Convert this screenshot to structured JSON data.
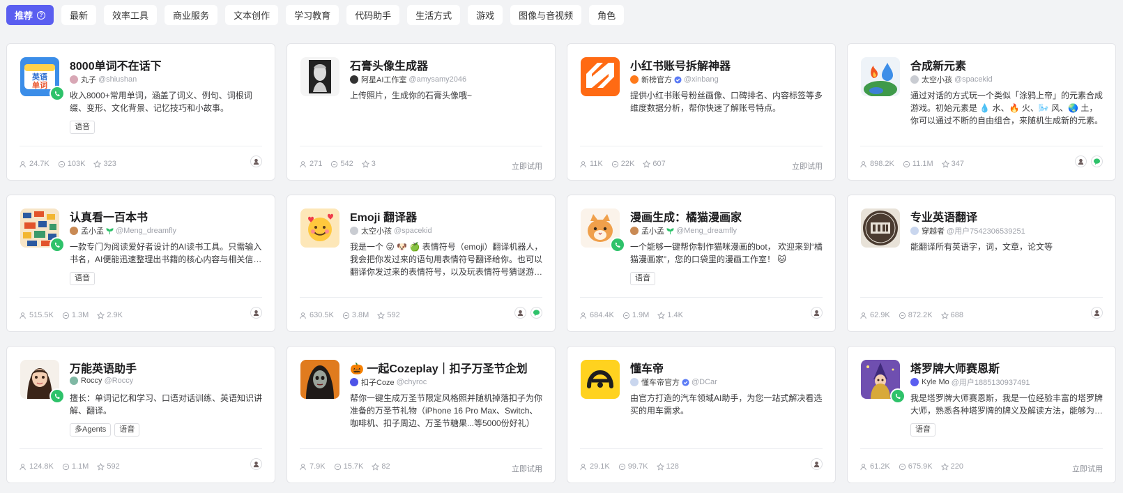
{
  "tabs": [
    {
      "label": "推荐",
      "active": true
    },
    {
      "label": "最新"
    },
    {
      "label": "效率工具"
    },
    {
      "label": "商业服务"
    },
    {
      "label": "文本创作"
    },
    {
      "label": "学习教育"
    },
    {
      "label": "代码助手"
    },
    {
      "label": "生活方式"
    },
    {
      "label": "游戏"
    },
    {
      "label": "图像与音视频"
    },
    {
      "label": "角色"
    }
  ],
  "help_icon": "?",
  "cards": [
    {
      "title": "8000单词不在话下",
      "author": "丸子",
      "handle": "@shiushan",
      "desc": "收入8000+常用单词，涵盖了词义、例句、词根词缀、变形、文化背景、记忆技巧和小故事。",
      "tags": [
        "语音"
      ],
      "users": "24.7K",
      "chats": "103K",
      "stars": "323",
      "try": ""
    },
    {
      "title": "石膏头像生成器",
      "author": "阿星AI工作室",
      "handle": "@amysamy2046",
      "desc": "上传照片，生成你的石膏头像哦~",
      "tags": [],
      "users": "271",
      "chats": "542",
      "stars": "3",
      "try": "立即试用"
    },
    {
      "title": "小红书账号拆解神器",
      "author": "新榜官方",
      "handle": "@xinbang",
      "desc": "提供小红书账号粉丝画像、口碑排名、内容标签等多维度数据分析，帮你快速了解账号特点。",
      "tags": [],
      "users": "11K",
      "chats": "22K",
      "stars": "607",
      "try": "立即试用"
    },
    {
      "title": "合成新元素",
      "author": "太空小孩",
      "handle": "@spacekid",
      "desc": "通过对话的方式玩一个类似「涂鸦上帝」的元素合成游戏。初始元素是 💧 水、🔥 火、🌬️ 风、🌏 土，你可以通过不断的自由组合，来随机生成新的元素。",
      "tags": [],
      "users": "898.2K",
      "chats": "11.1M",
      "stars": "347",
      "try": ""
    },
    {
      "title": "认真看一百本书",
      "author": "孟小孟",
      "handle": "@Meng_dreamfly",
      "desc": "一款专门为阅读爱好者设计的AI读书工具。只需输入书名，AI便能迅速整理出书籍的核心内容与相关信息。",
      "tags": [
        "语音"
      ],
      "users": "515.5K",
      "chats": "1.3M",
      "stars": "2.9K",
      "try": ""
    },
    {
      "title": "Emoji 翻译器",
      "author": "太空小孩",
      "handle": "@spacekid",
      "desc": "我是一个 😜 🐶 🍏 表情符号（emoji）翻译机器人，我会把你发过来的语句用表情符号翻译给你。也可以翻译你发过来的表情符号，以及玩表情符号猜谜游戏。",
      "tags": [],
      "users": "630.5K",
      "chats": "3.8M",
      "stars": "592",
      "try": ""
    },
    {
      "title": "漫画生成：橘猫漫画家",
      "author": "孟小孟",
      "handle": "@Meng_dreamfly",
      "desc": "一个能够一键帮你制作猫咪漫画的bot， 欢迎来到“橘猫漫画家”，您的口袋里的漫画工作室！ 🐱",
      "tags": [
        "语音"
      ],
      "users": "684.4K",
      "chats": "1.9M",
      "stars": "1.4K",
      "try": ""
    },
    {
      "title": "专业英语翻译",
      "author": "穿越者",
      "handle": "@用户7542306539251",
      "desc": "能翻译所有英语字，词，文章，论文等",
      "tags": [],
      "users": "62.9K",
      "chats": "872.2K",
      "stars": "688",
      "try": ""
    },
    {
      "title": "万能英语助手",
      "author": "Roccy",
      "handle": "@Roccy",
      "desc": "擅长：单词记忆和学习、口语对话训练、英语知识讲解、翻译。",
      "tags": [
        "多Agents",
        "语音"
      ],
      "users": "124.8K",
      "chats": "1.1M",
      "stars": "592",
      "try": ""
    },
    {
      "title": "🎃 一起Cozeplay｜扣子万圣节企划",
      "author": "扣子Coze",
      "handle": "@chyroc",
      "desc": "帮你一键生成万圣节限定风格照并随机掉落扣子为你准备的万圣节礼物（iPhone 16 Pro Max、Switch、咖啡机、扣子周边、万圣节糖果...等5000份好礼）",
      "tags": [],
      "users": "7.9K",
      "chats": "15.7K",
      "stars": "82",
      "try": "立即试用"
    },
    {
      "title": "懂车帝",
      "author": "懂车帝官方",
      "handle": "@DCar",
      "desc": "由官方打造的汽车领域AI助手，为您一站式解决看选买的用车需求。",
      "tags": [],
      "users": "29.1K",
      "chats": "99.7K",
      "stars": "128",
      "try": ""
    },
    {
      "title": "塔罗牌大师赛恩斯",
      "author": "Kyle Mo",
      "handle": "@用户1885130937491",
      "desc": "我是塔罗牌大师赛恩斯，我是一位经验丰富的塔罗牌大师，熟悉各种塔罗牌的牌义及解读方法，能够为你提供准确的塔罗牌占卜。",
      "tags": [
        "语音"
      ],
      "users": "61.2K",
      "chats": "675.9K",
      "stars": "220",
      "try": "立即试用"
    }
  ],
  "colors": {
    "accent": "#5a5ef0",
    "call_green": "#2ec26a",
    "verified_blue": "#5b7bf5"
  },
  "icons": [
    "help-icon",
    "phone-icon",
    "users-icon",
    "chat-icon",
    "star-icon",
    "verified-icon",
    "wechat-icon",
    "avatar-icon"
  ]
}
